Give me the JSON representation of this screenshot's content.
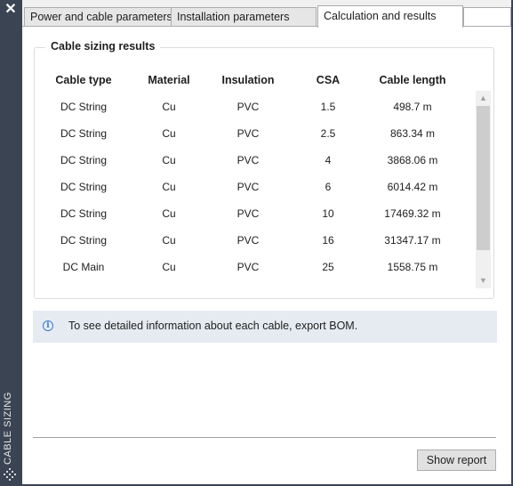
{
  "sidebar": {
    "title": "CABLE SIZING",
    "close_icon": "close-icon",
    "grip_icon": "resize-grip-icon",
    "background": "#3b4453"
  },
  "tabs": [
    {
      "label": "Power and cable parameters",
      "active": false
    },
    {
      "label": "Installation parameters",
      "active": false
    },
    {
      "label": "Calculation and results",
      "active": true
    }
  ],
  "results": {
    "title": "Cable sizing results",
    "columns": [
      "Cable type",
      "Material",
      "Insulation",
      "CSA",
      "Cable length"
    ],
    "rows": [
      [
        "DC String",
        "Cu",
        "PVC",
        "1.5",
        "498.7 m"
      ],
      [
        "DC String",
        "Cu",
        "PVC",
        "2.5",
        "863.34 m"
      ],
      [
        "DC String",
        "Cu",
        "PVC",
        "4",
        "3868.06 m"
      ],
      [
        "DC String",
        "Cu",
        "PVC",
        "6",
        "6014.42 m"
      ],
      [
        "DC String",
        "Cu",
        "PVC",
        "10",
        "17469.32 m"
      ],
      [
        "DC String",
        "Cu",
        "PVC",
        "16",
        "31347.17 m"
      ],
      [
        "DC Main",
        "Cu",
        "PVC",
        "25",
        "1558.75 m"
      ]
    ]
  },
  "info": {
    "icon": "info-icon",
    "text": "To see detailed information about each cable, export BOM."
  },
  "footer": {
    "report_label": "Show report"
  },
  "colors": {
    "info_background": "#e6ebf1",
    "info_accent": "#3a7bd5"
  }
}
